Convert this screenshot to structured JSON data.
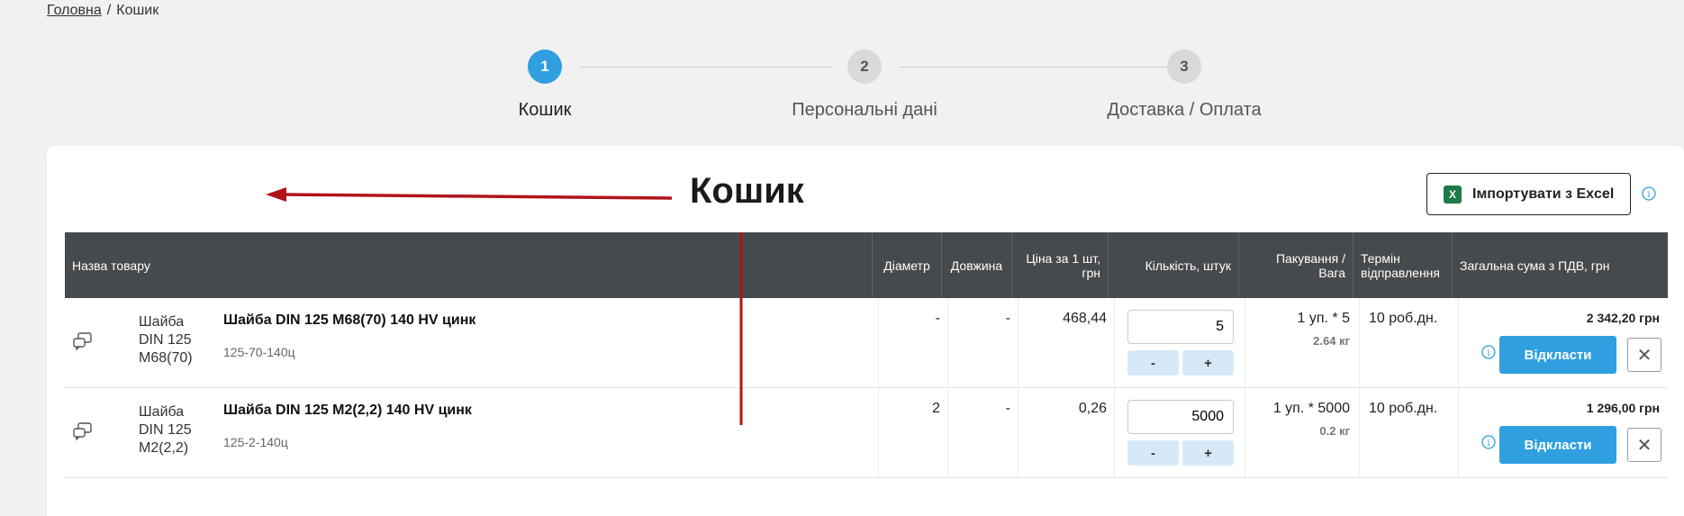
{
  "breadcrumb": {
    "home": "Головна",
    "separator": "/",
    "current": "Кошик"
  },
  "steps": [
    {
      "number": "1",
      "label": "Кошик",
      "active": true
    },
    {
      "number": "2",
      "label": "Персональні дані",
      "active": false
    },
    {
      "number": "3",
      "label": "Доставка / Оплата",
      "active": false
    }
  ],
  "cart": {
    "title": "Кошик",
    "import_label": "Імпортувати з Excel",
    "excel_icon_glyph": "X",
    "info_glyph": "i"
  },
  "table": {
    "headers": {
      "name": "Назва товару",
      "diameter": "Діаметр",
      "length": "Довжина",
      "price": "Ціна за 1 шт, грн",
      "quantity": "Кількість, штук",
      "packing": "Пакування / Вага",
      "term": "Термін відправлення",
      "total": "Загальна сума з ПДВ, грн"
    },
    "rows": [
      {
        "image_alt": "Шайба DIN 125 М68(70)",
        "name": "Шайба DIN 125 М68(70) 140 HV цинк",
        "code": "125-70-140ц",
        "diameter": "-",
        "length": "-",
        "price": "468,44",
        "quantity": "5",
        "minus": "-",
        "plus": "+",
        "packing": "1 уп. * 5",
        "weight": "2.64 кг",
        "term": "10 роб.дн.",
        "total": "2 342,20 грн",
        "defer": "Відкласти",
        "remove": "✕"
      },
      {
        "image_alt": "Шайба DIN 125 М2(2,2)",
        "name": "Шайба DIN 125 М2(2,2) 140 HV цинк",
        "code": "125-2-140ц",
        "diameter": "2",
        "length": "-",
        "price": "0,26",
        "quantity": "5000",
        "minus": "-",
        "plus": "+",
        "packing": "1 уп. * 5000",
        "weight": "0.2 кг",
        "term": "10 роб.дн.",
        "total": "1 296,00 грн",
        "defer": "Відкласти",
        "remove": "✕"
      }
    ]
  },
  "colors": {
    "accent": "#2f9fe0",
    "header_bg": "#474a4d",
    "annotation_red": "#b0141a",
    "qty_button_bg": "#d6e9f8"
  }
}
